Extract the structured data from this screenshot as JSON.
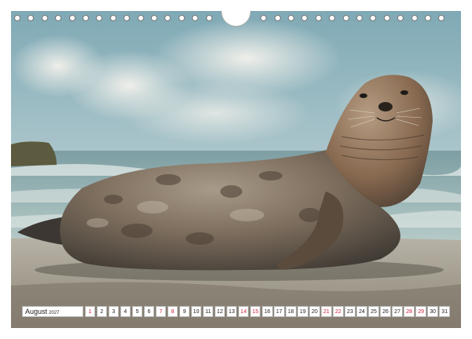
{
  "calendar": {
    "month": "August",
    "year": "2027",
    "days": [
      {
        "n": "1",
        "red": true
      },
      {
        "n": "2",
        "red": false
      },
      {
        "n": "3",
        "red": false
      },
      {
        "n": "4",
        "red": false
      },
      {
        "n": "5",
        "red": false
      },
      {
        "n": "6",
        "red": false
      },
      {
        "n": "7",
        "red": true
      },
      {
        "n": "8",
        "red": true
      },
      {
        "n": "9",
        "red": false
      },
      {
        "n": "10",
        "red": false
      },
      {
        "n": "11",
        "red": false
      },
      {
        "n": "12",
        "red": false
      },
      {
        "n": "13",
        "red": false
      },
      {
        "n": "14",
        "red": true
      },
      {
        "n": "15",
        "red": true
      },
      {
        "n": "16",
        "red": false
      },
      {
        "n": "17",
        "red": false
      },
      {
        "n": "18",
        "red": false
      },
      {
        "n": "19",
        "red": false
      },
      {
        "n": "20",
        "red": false
      },
      {
        "n": "21",
        "red": true
      },
      {
        "n": "22",
        "red": true
      },
      {
        "n": "23",
        "red": false
      },
      {
        "n": "24",
        "red": false
      },
      {
        "n": "25",
        "red": false
      },
      {
        "n": "26",
        "red": false
      },
      {
        "n": "27",
        "red": false
      },
      {
        "n": "28",
        "red": true
      },
      {
        "n": "29",
        "red": true
      },
      {
        "n": "30",
        "red": false
      },
      {
        "n": "31",
        "red": false
      }
    ],
    "weekend_color": "#d0203c"
  },
  "binding": {
    "ring_count": 32
  }
}
